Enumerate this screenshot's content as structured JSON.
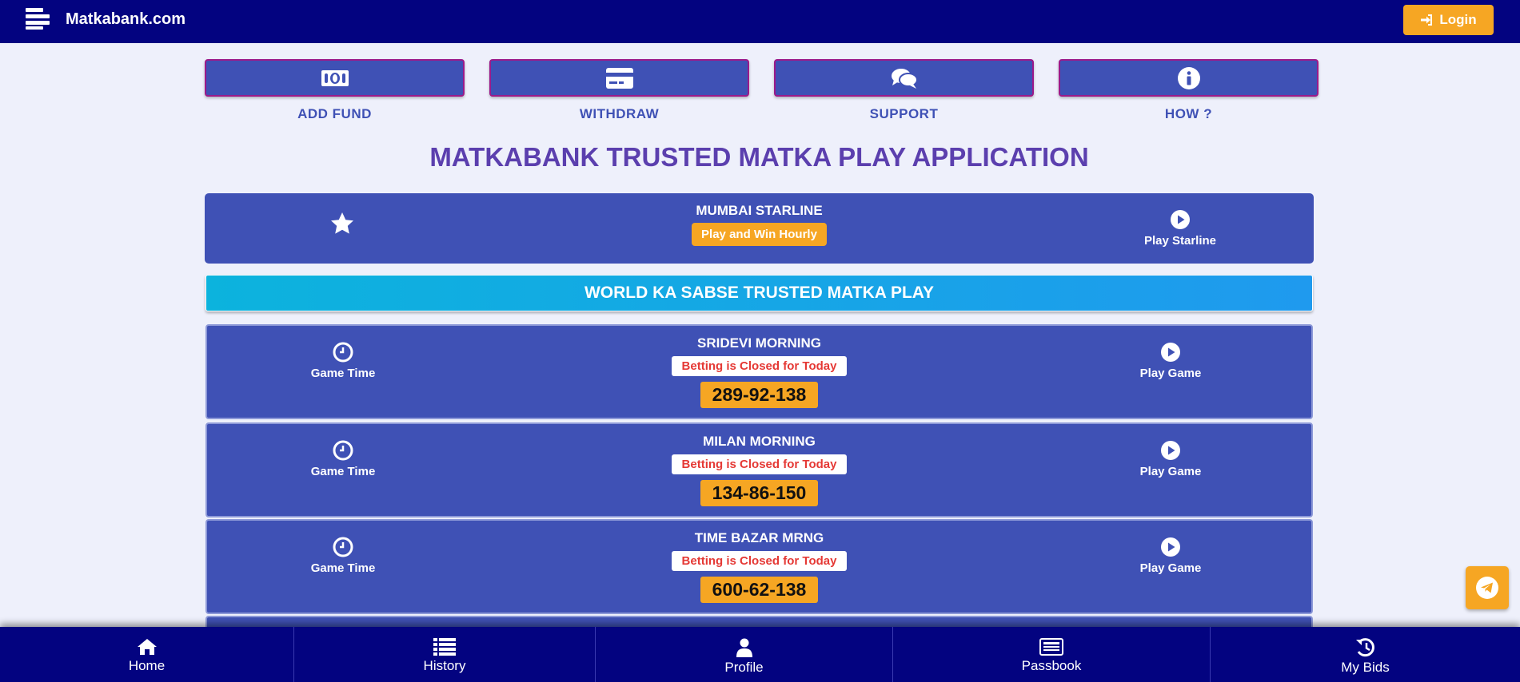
{
  "header": {
    "brand": "Matkabank.com",
    "login_label": "Login"
  },
  "quick_actions": [
    {
      "label": "ADD FUND",
      "icon": "money-bill-icon"
    },
    {
      "label": "WITHDRAW",
      "icon": "credit-card-icon"
    },
    {
      "label": "SUPPORT",
      "icon": "chat-bubbles-icon"
    },
    {
      "label": "HOW ?",
      "icon": "info-circle-icon"
    }
  ],
  "main_title": "MATKABANK TRUSTED MATKA PLAY APPLICATION",
  "starline": {
    "name": "MUMBAI STARLINE",
    "badge": "Play and Win Hourly",
    "play_label": "Play Starline"
  },
  "banner": "WORLD KA SABSE TRUSTED MATKA PLAY",
  "games": [
    {
      "name": "SRIDEVI MORNING",
      "status": "Betting is Closed for Today",
      "result": "289-92-138",
      "time_label": "Game Time",
      "play_label": "Play Game"
    },
    {
      "name": "MILAN MORNING",
      "status": "Betting is Closed for Today",
      "result": "134-86-150",
      "time_label": "Game Time",
      "play_label": "Play Game"
    },
    {
      "name": "TIME BAZAR MRNG",
      "status": "Betting is Closed for Today",
      "result": "600-62-138",
      "time_label": "Game Time",
      "play_label": "Play Game"
    }
  ],
  "bottom_nav": [
    {
      "label": "Home",
      "icon": "home-icon"
    },
    {
      "label": "History",
      "icon": "list-icon"
    },
    {
      "label": "Profile",
      "icon": "user-icon"
    },
    {
      "label": "Passbook",
      "icon": "passbook-icon"
    },
    {
      "label": "My Bids",
      "icon": "history-icon"
    }
  ],
  "colors": {
    "navy": "#030380",
    "primary": "#3f51b5",
    "accent": "#f6a623",
    "title": "#5b3fae",
    "closed_text": "#e53935",
    "page_bg": "#eef0fb"
  }
}
